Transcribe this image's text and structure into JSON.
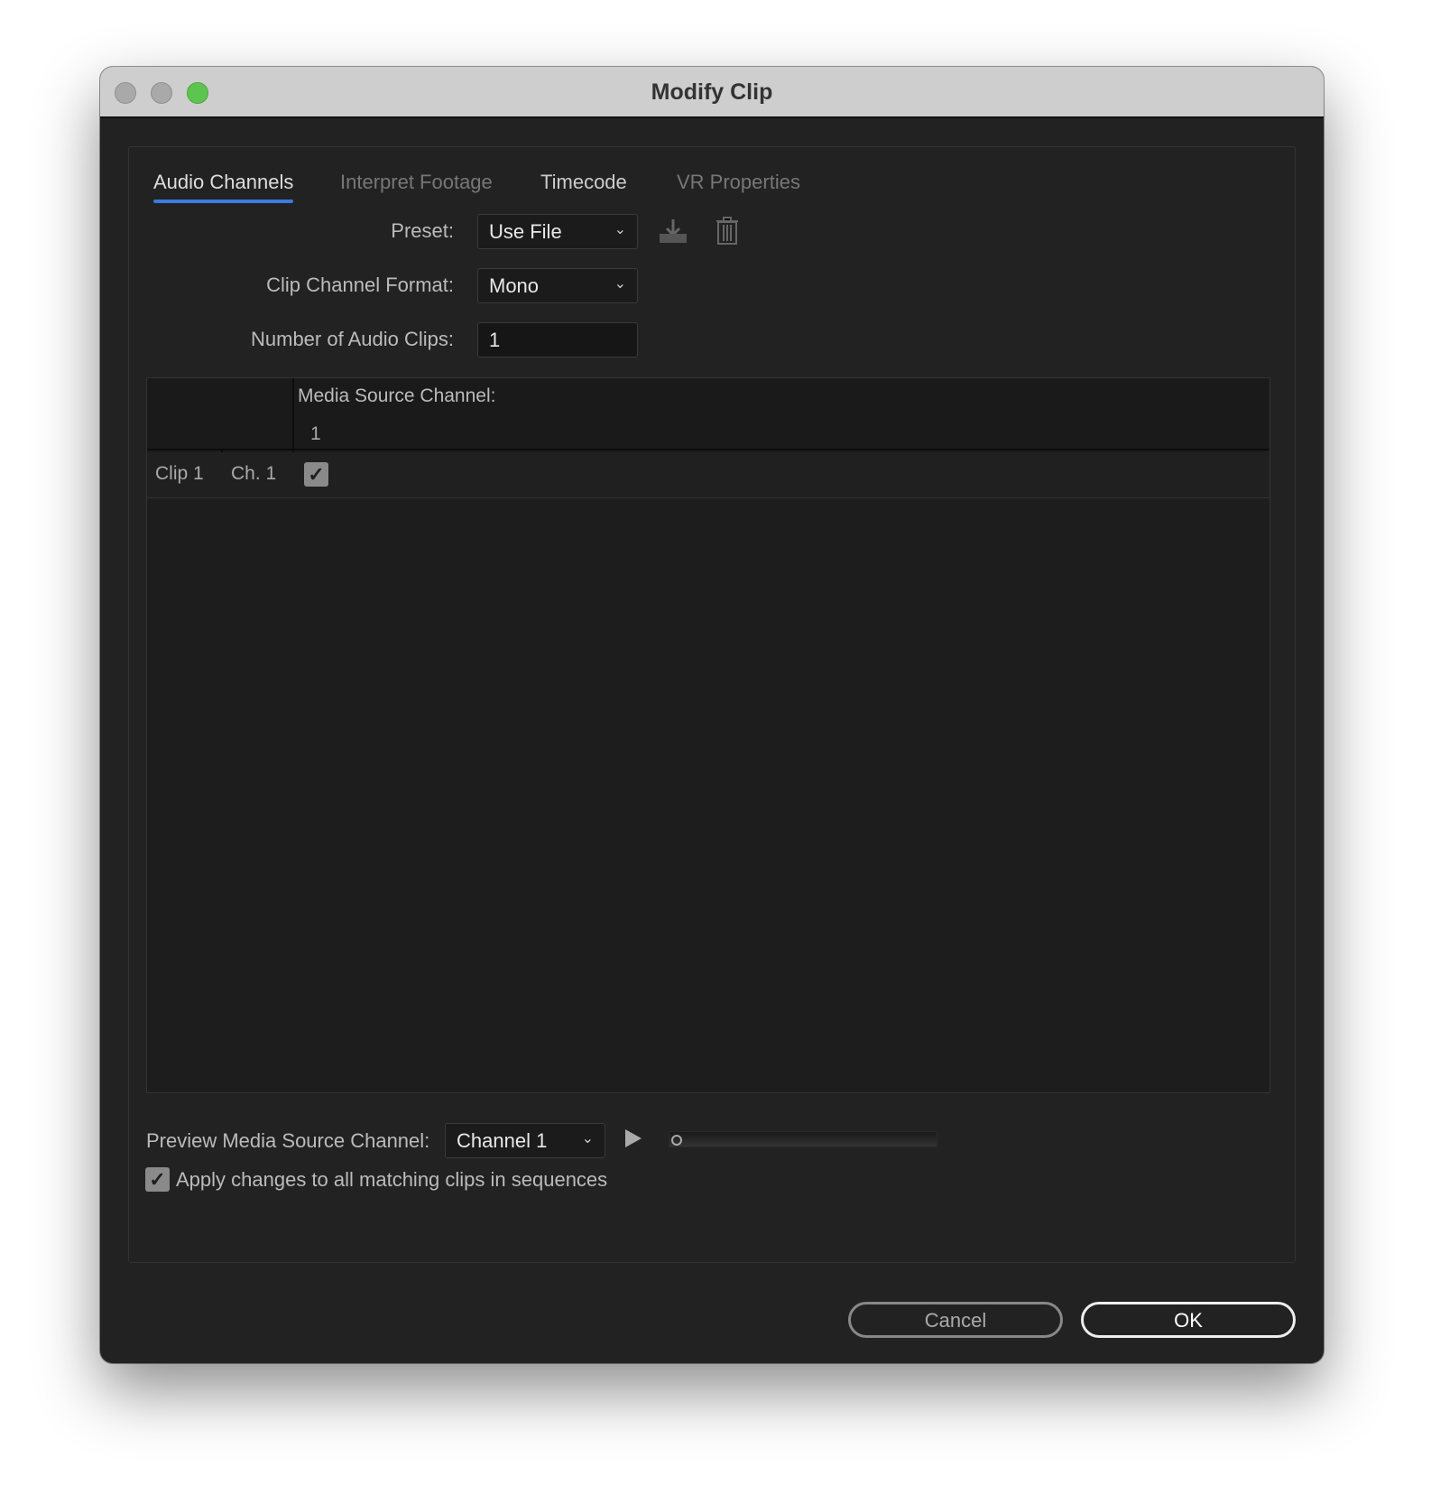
{
  "window": {
    "title": "Modify Clip"
  },
  "tabs": [
    {
      "label": "Audio Channels",
      "active": true
    },
    {
      "label": "Interpret Footage",
      "disabled": true
    },
    {
      "label": "Timecode"
    },
    {
      "label": "VR Properties",
      "disabled": true
    }
  ],
  "form": {
    "preset_label": "Preset:",
    "preset_value": "Use File",
    "format_label": "Clip Channel Format:",
    "format_value": "Mono",
    "num_label": "Number of Audio Clips:",
    "num_value": "1"
  },
  "table": {
    "header": "Media Source Channel:",
    "columns": [
      "1"
    ],
    "rows": [
      {
        "clip": "Clip 1",
        "channel": "Ch. 1",
        "checked": [
          true
        ]
      }
    ]
  },
  "preview": {
    "label": "Preview Media Source Channel:",
    "channel": "Channel 1",
    "progress": 0
  },
  "apply": {
    "label": "Apply changes to all matching clips in sequences",
    "checked": true
  },
  "buttons": {
    "cancel": "Cancel",
    "ok": "OK"
  },
  "colors": {
    "accent": "#3b7be0",
    "green": "#5dc54f"
  }
}
